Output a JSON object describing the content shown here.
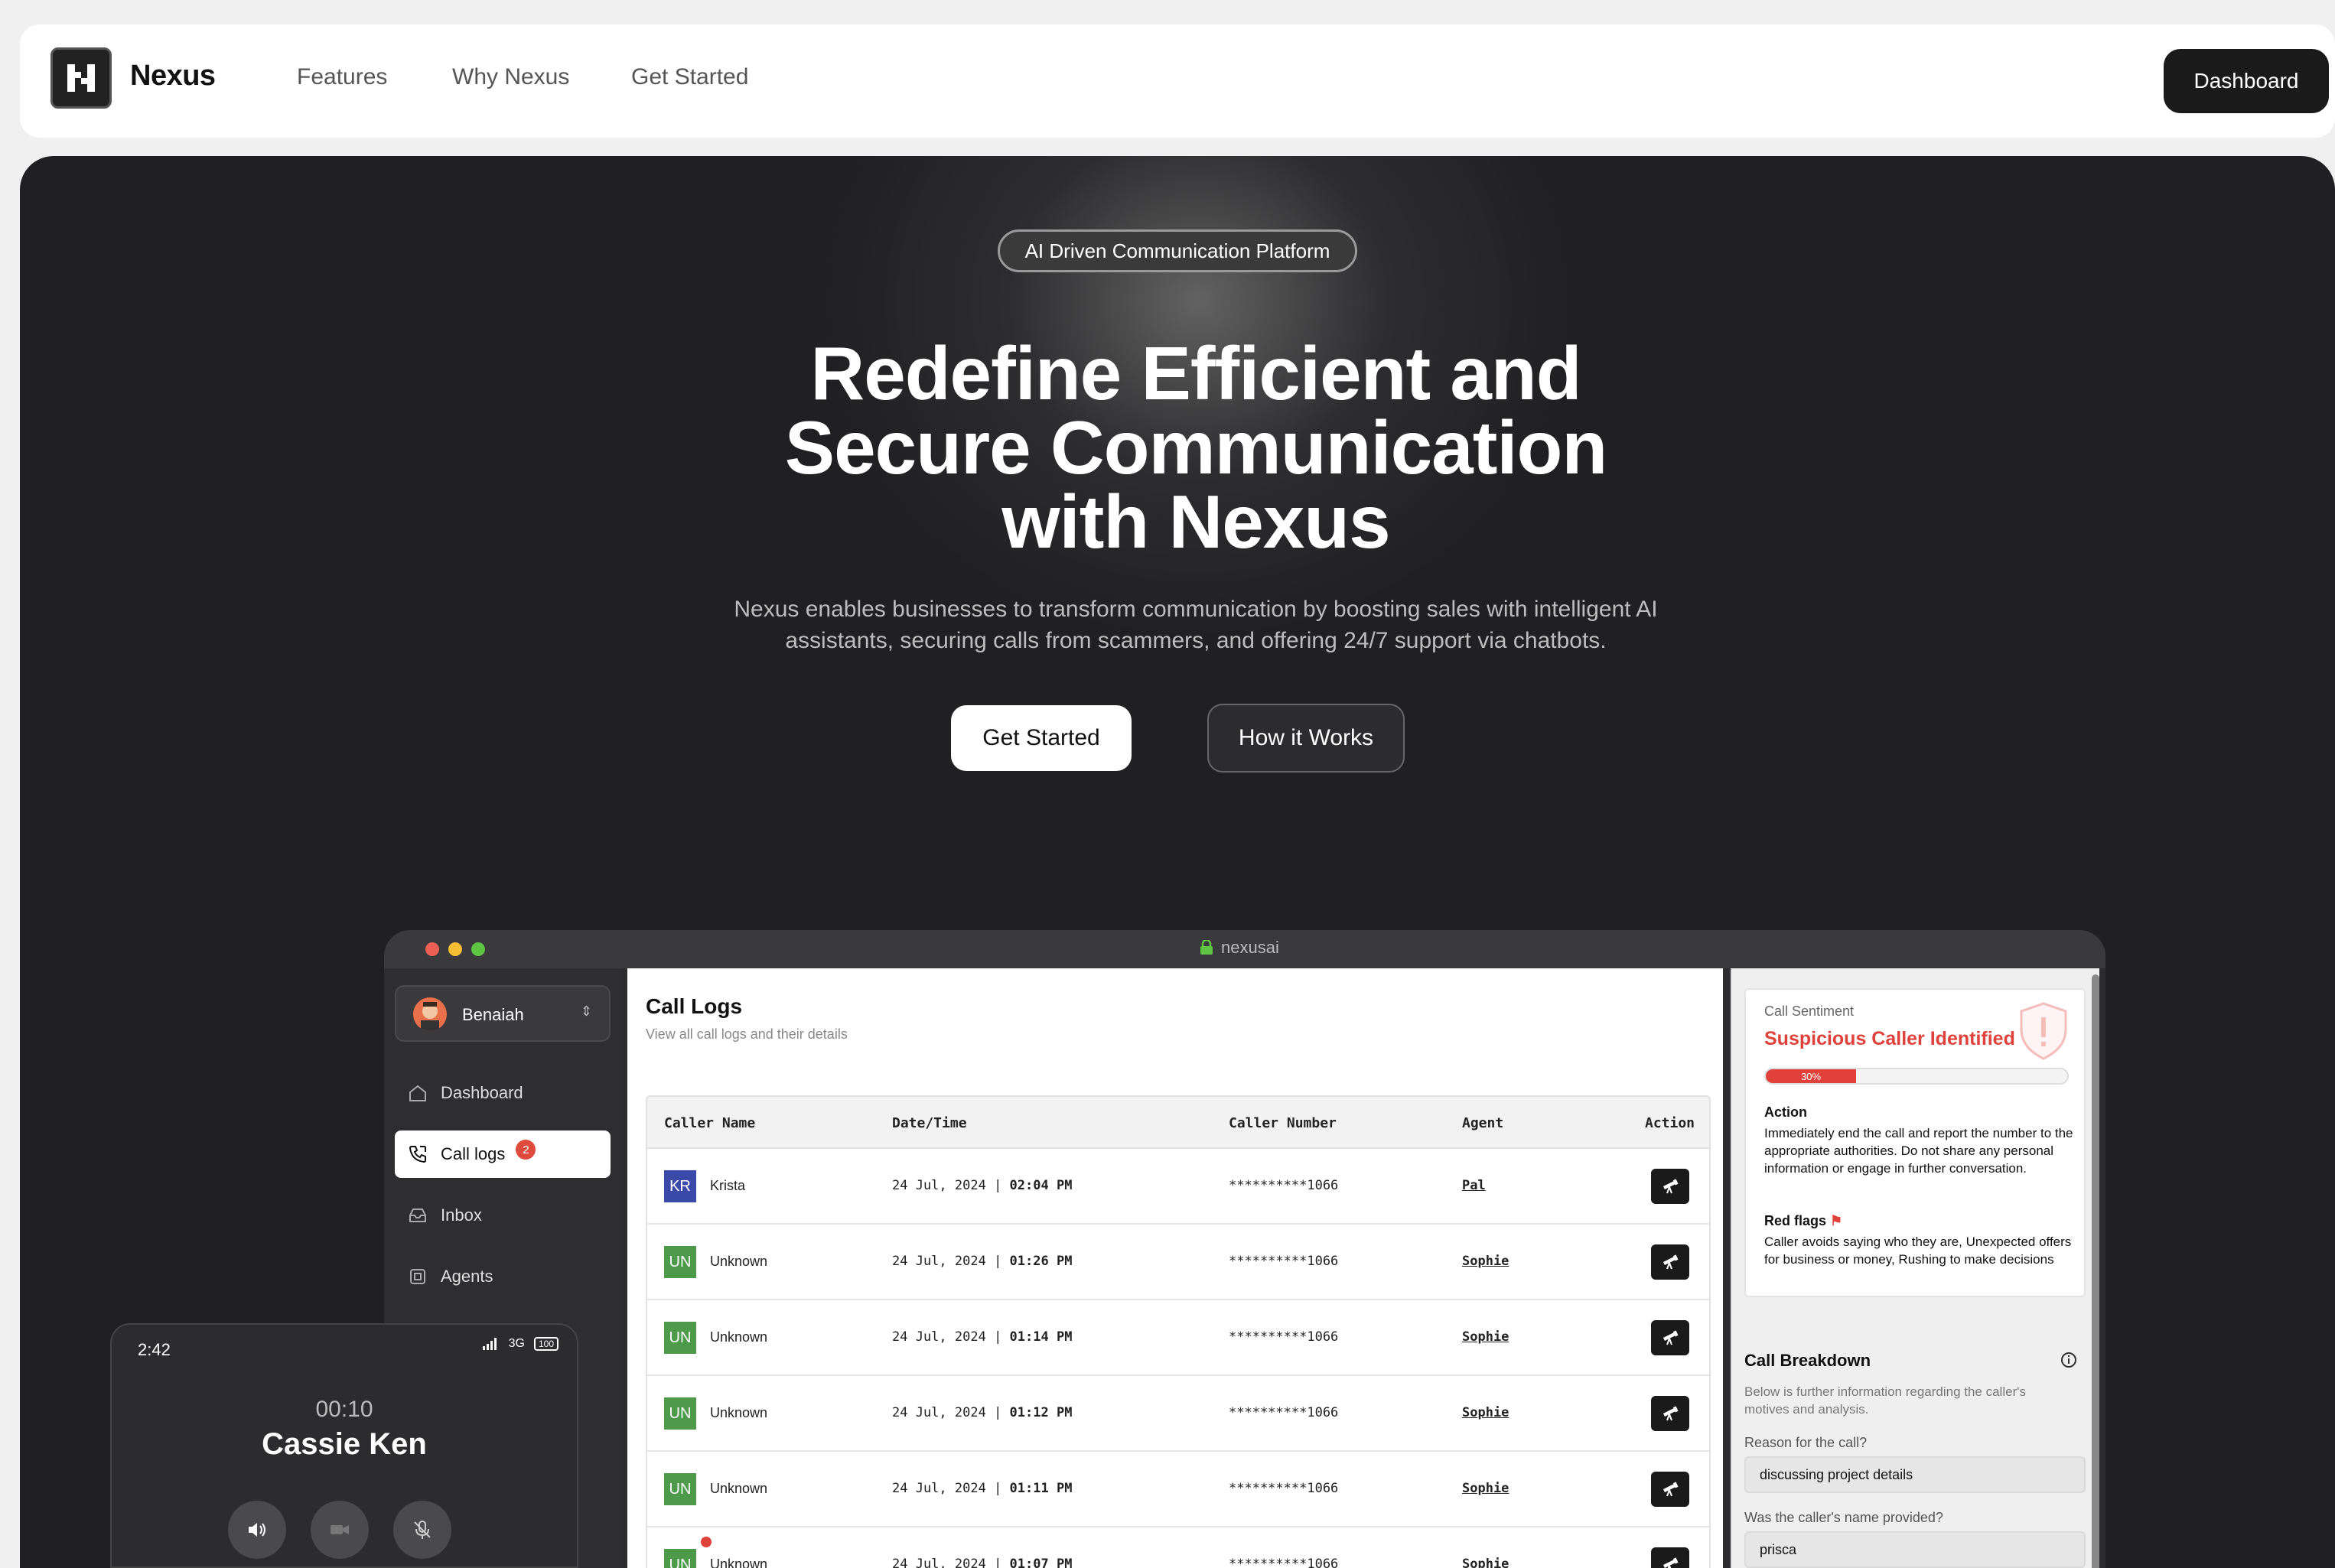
{
  "nav": {
    "brand": "Nexus",
    "links": [
      "Features",
      "Why Nexus",
      "Get Started"
    ],
    "dashboard_label": "Dashboard"
  },
  "hero": {
    "pill": "AI Driven Communication Platform",
    "headline_line1": "Redefine Efficient and",
    "headline_line2": "Secure Communication",
    "headline_line3": "with Nexus",
    "subtitle": "Nexus enables businesses to transform communication by boosting sales with intelligent AI assistants, securing calls from scammers, and offering 24/7 support via chatbots.",
    "primary_cta": "Get Started",
    "secondary_cta": "How it Works"
  },
  "app": {
    "url": "nexusai",
    "user": "Benaiah",
    "sidebar": [
      {
        "label": "Dashboard",
        "icon": "home-icon"
      },
      {
        "label": "Call logs",
        "icon": "phone-icon",
        "badge": "2"
      },
      {
        "label": "Inbox",
        "icon": "inbox-icon"
      },
      {
        "label": "Agents",
        "icon": "chip-icon"
      }
    ],
    "main": {
      "title": "Call Logs",
      "subtitle": "View all call logs and their details",
      "columns": [
        "Caller Name",
        "Date/Time",
        "Caller Number",
        "Agent",
        "Action"
      ],
      "rows": [
        {
          "initials": "KR",
          "color": "#3b4aa8",
          "name": "Krista",
          "date": "24 Jul, 2024",
          "time": "02:04 PM",
          "number": "**********1066",
          "agent": "Pal"
        },
        {
          "initials": "UN",
          "color": "#4c9a4a",
          "name": "Unknown",
          "date": "24 Jul, 2024",
          "time": "01:26 PM",
          "number": "**********1066",
          "agent": "Sophie"
        },
        {
          "initials": "UN",
          "color": "#4c9a4a",
          "name": "Unknown",
          "date": "24 Jul, 2024",
          "time": "01:14 PM",
          "number": "**********1066",
          "agent": "Sophie"
        },
        {
          "initials": "UN",
          "color": "#4c9a4a",
          "name": "Unknown",
          "date": "24 Jul, 2024",
          "time": "01:12 PM",
          "number": "**********1066",
          "agent": "Sophie"
        },
        {
          "initials": "UN",
          "color": "#4c9a4a",
          "name": "Unknown",
          "date": "24 Jul, 2024",
          "time": "01:11 PM",
          "number": "**********1066",
          "agent": "Sophie"
        },
        {
          "initials": "UN",
          "color": "#4c9a4a",
          "name": "Unknown",
          "date": "24 Jul, 2024",
          "time": "01:07 PM",
          "number": "**********1066",
          "agent": "Sophie"
        }
      ]
    },
    "panel": {
      "sentiment_label": "Call Sentiment",
      "sentiment_value": "Suspicious Caller Identified",
      "sentiment_percent": "30%",
      "sentiment_fraction": 0.3,
      "action_label": "Action",
      "action_text": "Immediately end the call and report the number to the appropriate authorities. Do not share any personal information or engage in further conversation.",
      "red_flags_label": "Red flags",
      "red_flags_text": "Caller avoids saying who they are, Unexpected offers for business or money, Rushing to make decisions",
      "breakdown_title": "Call Breakdown",
      "breakdown_sub": "Below is further information regarding the caller's motives and analysis.",
      "q1": "Reason for the call?",
      "a1": "discussing project details",
      "q2": "Was the caller's name provided?",
      "a2": "prisca"
    }
  },
  "phone": {
    "clock": "2:42",
    "network": "3G",
    "battery": "100",
    "duration": "00:10",
    "caller": "Cassie Ken"
  },
  "colors": {
    "accent_red": "#e0413b",
    "hero_bg": "#202022",
    "nav_bg": "#ffffff"
  }
}
